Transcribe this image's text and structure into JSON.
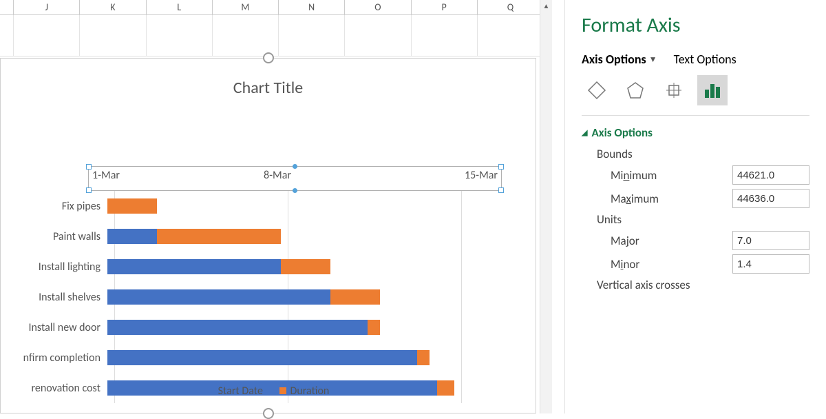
{
  "columns": [
    "",
    "J",
    "K",
    "L",
    "M",
    "N",
    "O",
    "P",
    "Q"
  ],
  "chart_data": {
    "type": "bar",
    "title": "Chart Title",
    "xlabel": "",
    "ylabel": "",
    "x_ticks": [
      "1-Mar",
      "8-Mar",
      "15-Mar"
    ],
    "x_range_serial": [
      44621,
      44636
    ],
    "categories": [
      "Fix pipes",
      "Paint walls",
      "Install lighting",
      "Install shelves",
      "Install new door",
      "nfirm completion",
      "renovation cost"
    ],
    "series": [
      {
        "name": "Start Date",
        "values": [
          44621,
          44621,
          44621,
          44621,
          44621,
          44621,
          44621
        ]
      },
      {
        "name": "Duration",
        "values": [
          2,
          7,
          9,
          11,
          11,
          13,
          14
        ]
      }
    ],
    "gantt_rows": [
      {
        "offset_days": 0,
        "start_span": 0,
        "duration_span": 2
      },
      {
        "offset_days": 0,
        "start_span": 2,
        "duration_span": 5
      },
      {
        "offset_days": 0,
        "start_span": 7,
        "duration_span": 2
      },
      {
        "offset_days": 0,
        "start_span": 9,
        "duration_span": 2
      },
      {
        "offset_days": 0,
        "start_span": 10.5,
        "duration_span": 0.5
      },
      {
        "offset_days": 0,
        "start_span": 12.5,
        "duration_span": 0.5
      },
      {
        "offset_days": 0,
        "start_span": 13.3,
        "duration_span": 0.7
      }
    ],
    "legend": [
      "Start Date",
      "Duration"
    ]
  },
  "panel": {
    "title": "Format Axis",
    "tab_active": "Axis Options",
    "tab_other": "Text Options",
    "section": "Axis Options",
    "bounds_label": "Bounds",
    "min_label_pre": "Mi",
    "min_label_u": "n",
    "min_label_post": "imum",
    "max_label_pre": "Ma",
    "max_label_u": "x",
    "max_label_post": "imum",
    "units_label": "Units",
    "major_label_pre": "Ma",
    "major_label_u": "j",
    "major_label_post": "or",
    "minor_label_pre": "M",
    "minor_label_u": "i",
    "minor_label_post": "nor",
    "crosses_label": "Vertical axis crosses",
    "values": {
      "min": "44621.0",
      "max": "44636.0",
      "major": "7.0",
      "minor": "1.4"
    }
  }
}
